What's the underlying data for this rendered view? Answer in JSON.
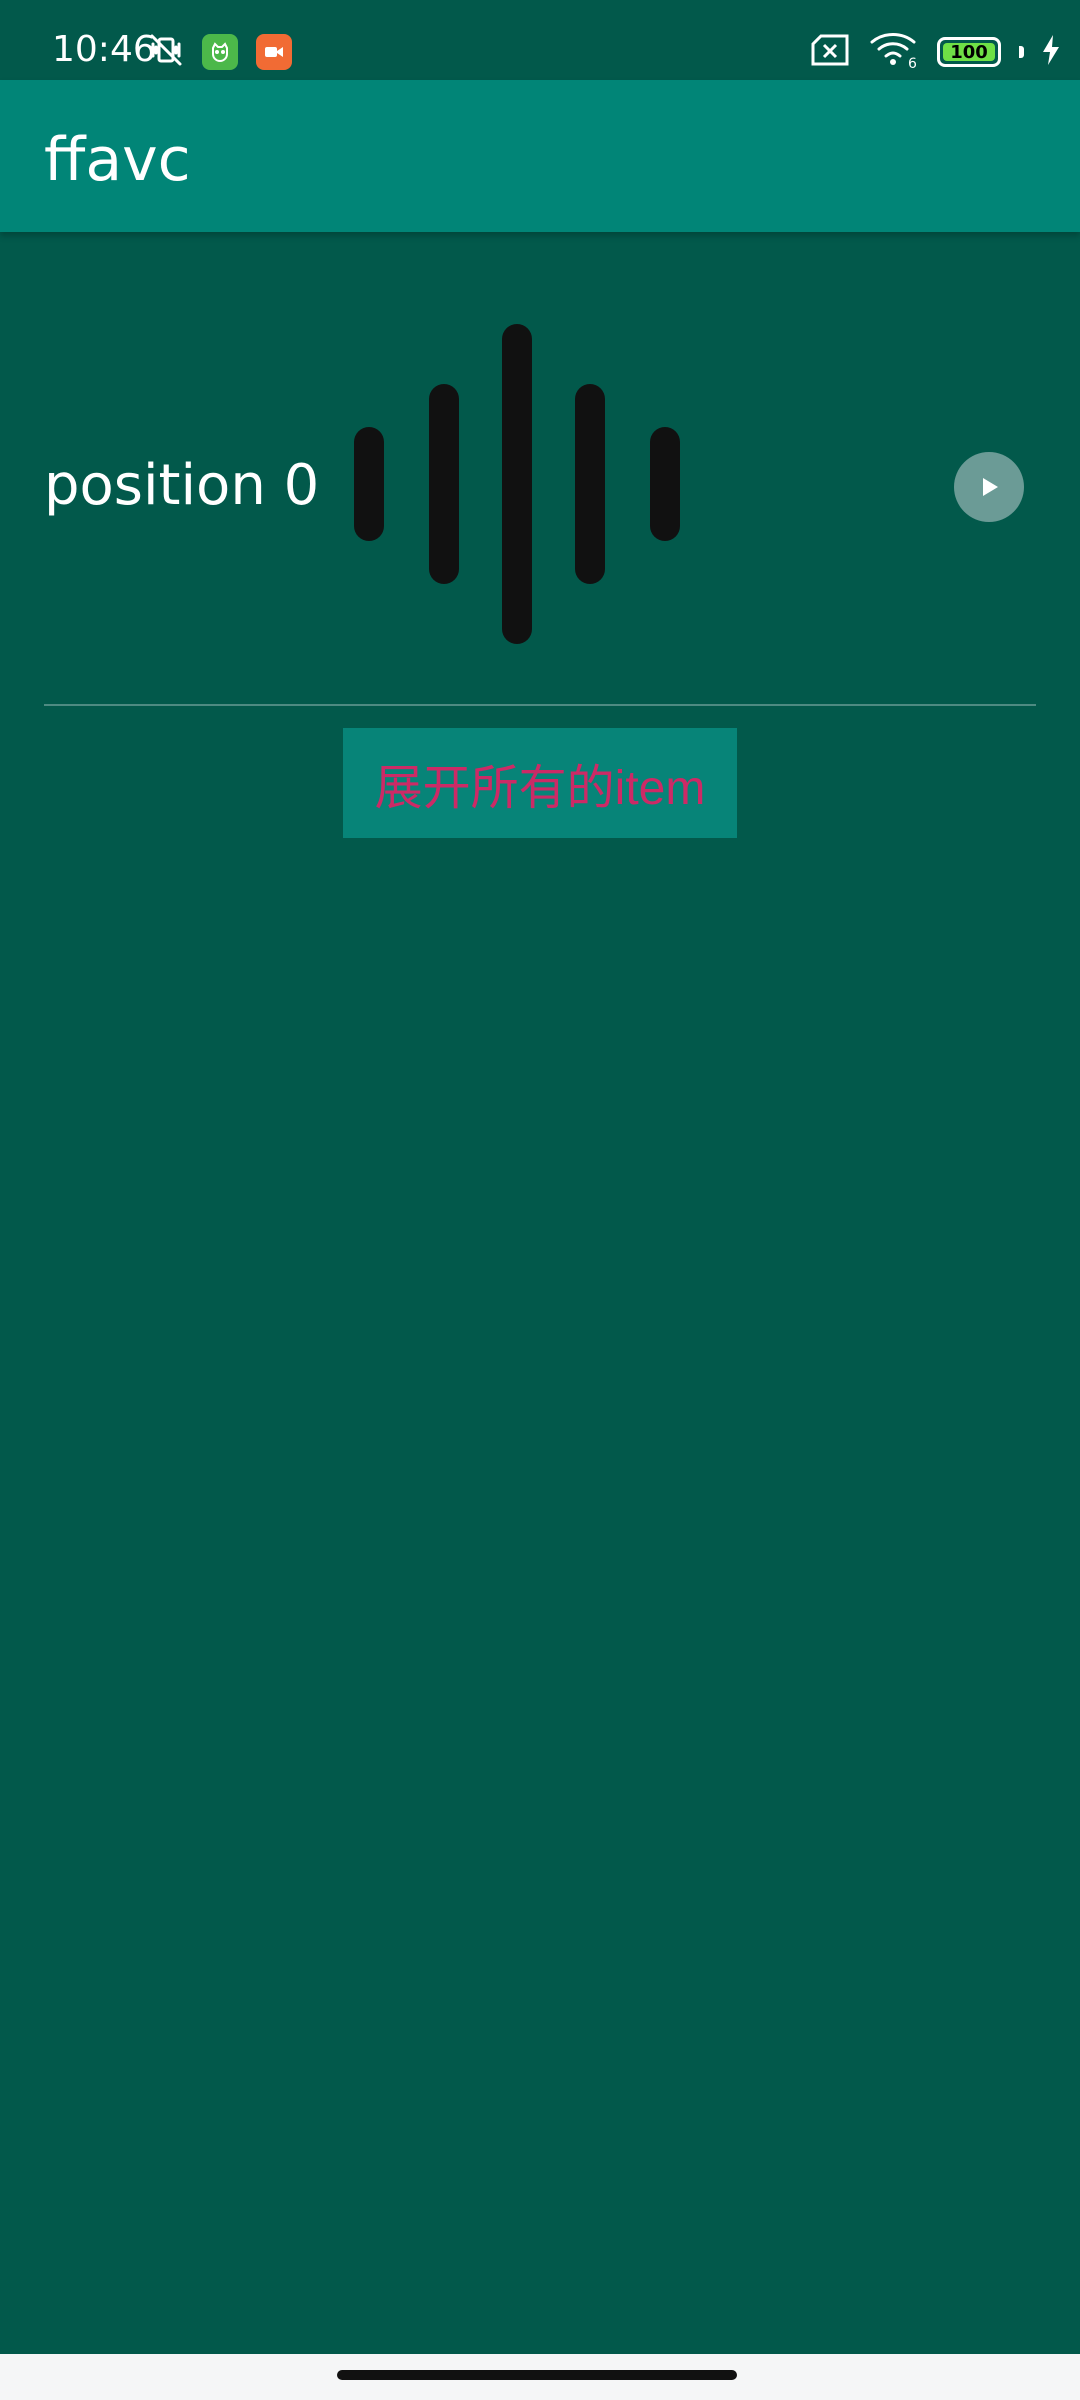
{
  "status_bar": {
    "time": "10:46",
    "left_icons": [
      "vibrate-off-icon",
      "cat-app-icon",
      "video-app-icon"
    ],
    "right_icons": [
      "sim-disabled-icon",
      "wifi-icon",
      "battery-icon",
      "charging-icon"
    ],
    "wifi_label": "6",
    "battery_level": "100",
    "colors": {
      "background": "#02594b",
      "battery_fill": "#6fe046",
      "cat_app": "#4cb84a",
      "video_app": "#f16b34"
    }
  },
  "app_bar": {
    "title": "ffavc",
    "background": "#018577"
  },
  "list": {
    "items": [
      {
        "label": "position 0",
        "waveform_icon": "waveform-icon",
        "play_icon": "play-icon"
      }
    ]
  },
  "actions": {
    "expand_all_label": "展开所有的item",
    "expand_all_color": "#cc2a66",
    "expand_all_background": "#078478"
  },
  "theme": {
    "page_background": "#02594b",
    "nav_background": "#f5f6f7"
  }
}
